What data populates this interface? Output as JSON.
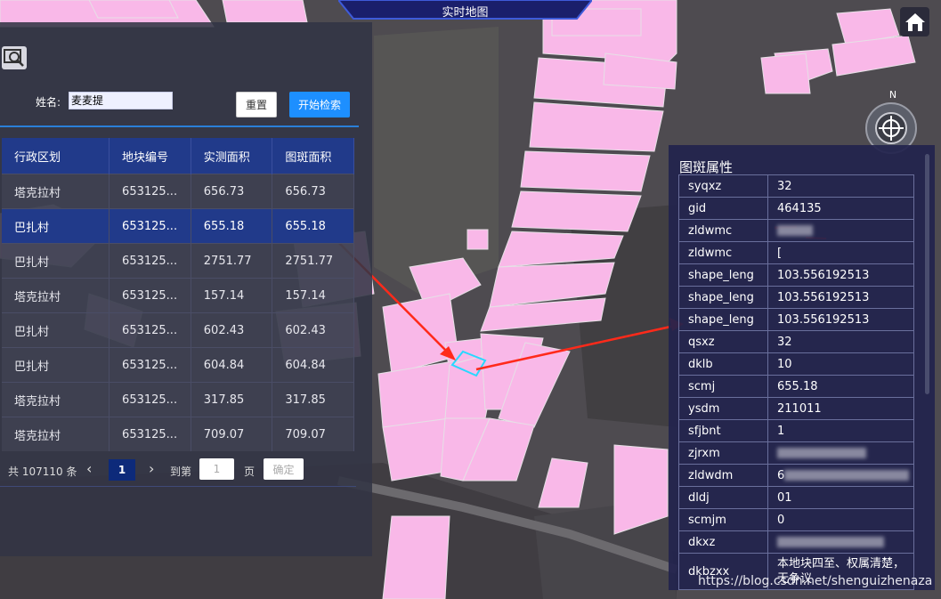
{
  "header": {
    "title": "实时地图"
  },
  "search": {
    "name_label": "姓名:",
    "name_value": "麦麦提",
    "reset_label": "重置",
    "search_label": "开始检索"
  },
  "table": {
    "columns": [
      "行政区划",
      "地块编号",
      "实测面积",
      "图斑面积"
    ],
    "rows": [
      [
        "塔克拉村",
        "653125...",
        "656.73",
        "656.73"
      ],
      [
        "巴扎村",
        "653125...",
        "655.18",
        "655.18"
      ],
      [
        "巴扎村",
        "653125...",
        "2751.77",
        "2751.77"
      ],
      [
        "塔克拉村",
        "653125...",
        "157.14",
        "157.14"
      ],
      [
        "巴扎村",
        "653125...",
        "602.43",
        "602.43"
      ],
      [
        "巴扎村",
        "653125...",
        "604.84",
        "604.84"
      ],
      [
        "塔克拉村",
        "653125...",
        "317.85",
        "317.85"
      ],
      [
        "塔克拉村",
        "653125...",
        "709.07",
        "709.07"
      ]
    ],
    "selected_row": 1
  },
  "pager": {
    "total": "共 107110 条",
    "prev": "‹",
    "current": "1",
    "next": "›",
    "goto_label": "到第",
    "goto_value": "1",
    "page_suffix": "页",
    "ok_label": "确定"
  },
  "attributes": {
    "title": "图斑属性",
    "rows": [
      [
        "syqxz",
        "32"
      ],
      [
        "gid",
        "464135"
      ],
      [
        "zldwmc",
        ""
      ],
      [
        "zldwmc",
        "["
      ],
      [
        "shape_leng",
        "103.556192513"
      ],
      [
        "shape_leng",
        "103.556192513"
      ],
      [
        "shape_leng",
        "103.556192513"
      ],
      [
        "qsxz",
        "32"
      ],
      [
        "dklb",
        "10"
      ],
      [
        "scmj",
        "655.18"
      ],
      [
        "ysdm",
        "211011"
      ],
      [
        "sfjbnt",
        "1"
      ],
      [
        "zjrxm",
        ""
      ],
      [
        "zldwdm",
        "6"
      ],
      [
        "dldj",
        "01"
      ],
      [
        "scmjm",
        "0"
      ],
      [
        "dkxz",
        ""
      ],
      [
        "dkbzxx",
        "本地块四至、权属清楚，无争议"
      ]
    ]
  },
  "compass": {
    "north_label": "N"
  },
  "watermark": "https://blog.csdn.net/shenguizhenaza",
  "colors": {
    "parcel": "#f9b8e8",
    "selected_outline": "#27d8ff",
    "arrow": "#ff2a1a",
    "panel": "#323444",
    "accent": "#1d8fff",
    "table_header": "#213a8a"
  }
}
